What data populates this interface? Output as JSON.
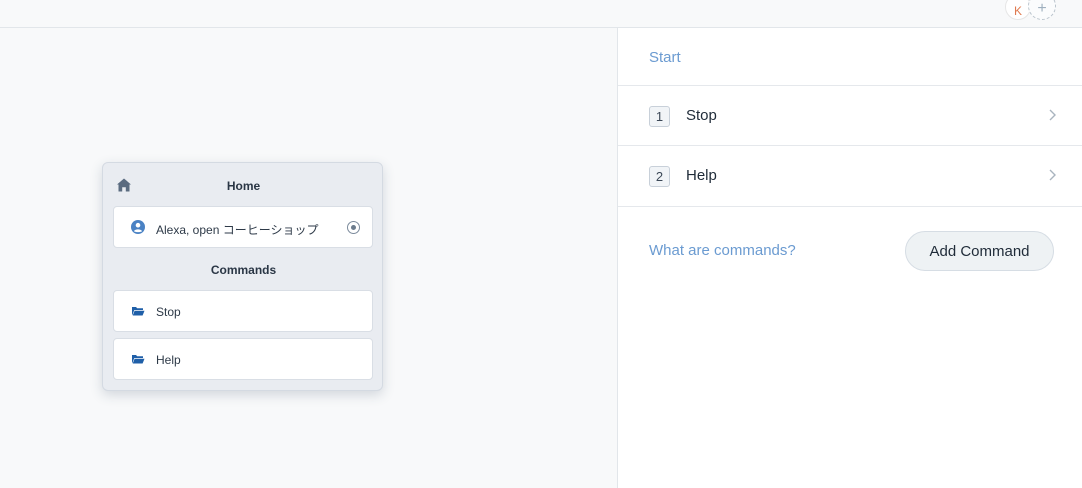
{
  "topbar": {
    "avatar_initial": "K",
    "add_collaborator_glyph": "+"
  },
  "canvas": {
    "block": {
      "title": "Home",
      "start_step": "Alexa, open コーヒーショップ",
      "commands_title": "Commands",
      "commands": [
        {
          "label": "Stop",
          "icon": "folder-icon"
        },
        {
          "label": "Help",
          "icon": "folder-icon"
        }
      ]
    }
  },
  "panel": {
    "start_label": "Start",
    "commands": [
      {
        "index": "1",
        "label": "Stop"
      },
      {
        "index": "2",
        "label": "Help"
      }
    ],
    "help_link": "What are commands?",
    "add_button": "Add Command"
  },
  "colors": {
    "link": "#6b9bd1",
    "avatar_text": "#e07a4f",
    "icon_blue": "#1f5fa8"
  }
}
